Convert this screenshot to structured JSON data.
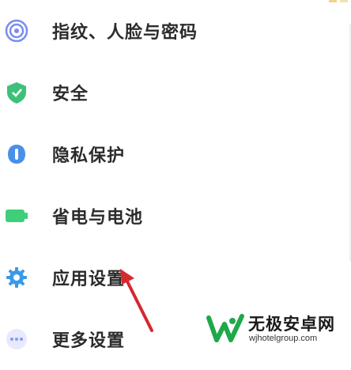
{
  "menu": {
    "items": [
      {
        "label": "指纹、人脸与密码",
        "icon": "fingerprint-icon"
      },
      {
        "label": "安全",
        "icon": "shield-icon"
      },
      {
        "label": "隐私保护",
        "icon": "privacy-icon"
      },
      {
        "label": "省电与电池",
        "icon": "battery-icon"
      },
      {
        "label": "应用设置",
        "icon": "gear-icon"
      },
      {
        "label": "更多设置",
        "icon": "more-icon"
      }
    ]
  },
  "watermark": {
    "title": "无极安卓网",
    "url": "wjhotelgroup.com"
  },
  "colors": {
    "fingerprint": "#7a8cf0",
    "shield": "#3fc07a",
    "privacy": "#4a90e8",
    "battery": "#3fcf7a",
    "gear": "#3a9ae8",
    "more": "#8a98f0",
    "arrow": "#d6282f",
    "logo": "#1fa84a"
  }
}
